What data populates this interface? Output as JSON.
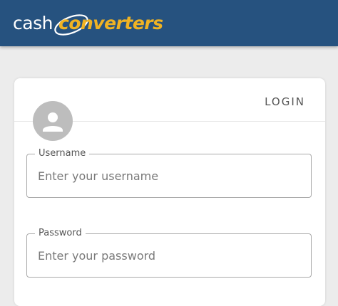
{
  "header": {
    "logo": {
      "word_cash": "cash",
      "word_converters": "converters",
      "colors": {
        "background": "#26527f",
        "cash": "#ffffff",
        "converters": "#f0b323"
      }
    }
  },
  "card": {
    "login_label": "LOGIN",
    "avatar_icon": "user-avatar-icon",
    "username": {
      "label": "Username",
      "placeholder": "Enter your username",
      "value": ""
    },
    "password": {
      "label": "Password",
      "placeholder": "Enter your password",
      "value": ""
    }
  }
}
